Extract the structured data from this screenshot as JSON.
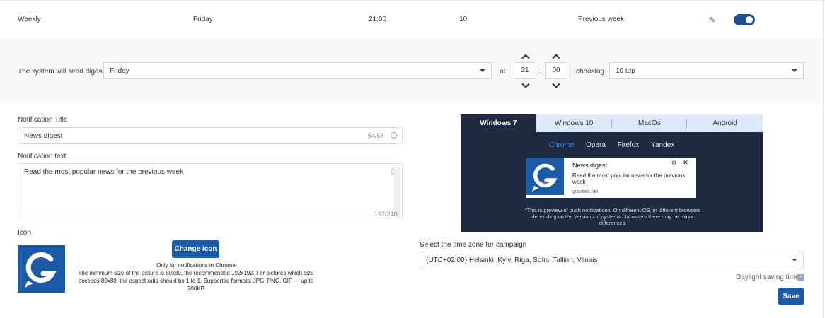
{
  "summary": {
    "frequency": "Weekly",
    "day": "Friday",
    "time": "21:00",
    "count": "10",
    "period": "Previous week",
    "enabled": true
  },
  "schedule": {
    "label": "The system will send digest",
    "day_value": "Friday",
    "at_label": "at",
    "hours": "21",
    "colon": ":",
    "minutes": "00",
    "choosing_label": "choosing",
    "choosing_value": "10 top"
  },
  "form": {
    "title_label": "Notification Title",
    "title_value": "News digest",
    "title_counter": "54/65",
    "text_label": "Notification text",
    "text_value": "Read the most popular news for the previous week",
    "text_counter": "192/240",
    "icon_label": "Icon",
    "change_icon": "Change icon",
    "icon_hint_1": "Only for notifications in Chrome",
    "icon_hint_2": "The minimum size of the picture is 80x80, the recommended 192x192. For pictures which size exceeds 80x80, the aspect ratio should be 1 to 1. Supported formats: JPG, PNG, GIF — up to 200KB"
  },
  "preview": {
    "os_tabs": [
      "Windows 7",
      "Windows 10",
      "MacOs",
      "Android"
    ],
    "active_os": 0,
    "browsers": [
      "Chrome",
      "Opera",
      "Firefox",
      "Yandex"
    ],
    "active_browser": 0,
    "notification": {
      "title": "News digest",
      "body": "Read the most popular news for the previous week",
      "site": "gravitec.net"
    },
    "note": "*This is preview of push notifications. On different OS, in different browsers depending on the versions of systems / browsers there may be minor differences."
  },
  "timezone": {
    "label": "Select the time zone for campaign",
    "value": "(UTC+02:00) Helsinki, Kyiv, Riga, Sofia, Tallinn, Vilnius",
    "dst_label": "Daylight saving time",
    "dst_checked": true
  },
  "save_label": "Save",
  "colors": {
    "accent": "#1b5aa6",
    "preview_bg": "#1e2a3f",
    "tabs_bg": "#dce9f8",
    "active_browser": "#2e8ef0"
  }
}
